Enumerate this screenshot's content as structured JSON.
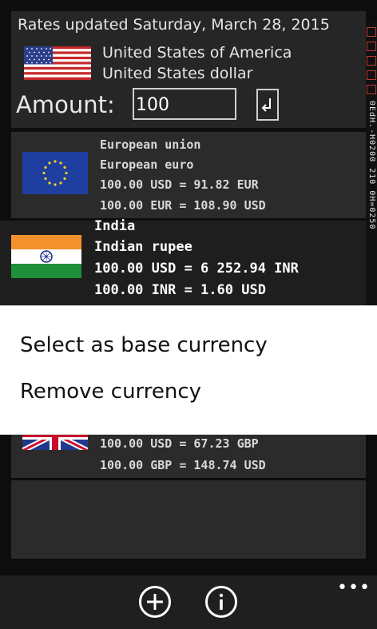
{
  "header": {
    "rates_updated": "Rates updated Saturday, March 28, 2015",
    "base_country": "United States of America",
    "base_currency": "United States dollar",
    "amount_label": "Amount:",
    "amount_value": "100"
  },
  "currencies": [
    {
      "country": "European union",
      "currency": "European euro",
      "rate_to": "100.00 USD = 91.82 EUR",
      "rate_from": "100.00 EUR = 108.90 USD"
    },
    {
      "country": "India",
      "currency": "Indian rupee",
      "rate_to": "100.00 USD = 6 252.94 INR",
      "rate_from": "100.00 INR = 1.60 USD"
    },
    {
      "country": "",
      "currency": "",
      "rate_to": "100.00 USD = 67.23 GBP",
      "rate_from": "100.00 GBP = 148.74 USD"
    }
  ],
  "context_menu": {
    "items": [
      "Select as base currency",
      "Remove currency"
    ]
  },
  "side_strip": {
    "text": "0EdH.-H0200 210 0H=0250"
  },
  "app_bar": {
    "add_icon": "add-icon",
    "info_icon": "info-icon",
    "more": "•••"
  },
  "colors": {
    "background": "#0d0d0d",
    "panel": "#2b2b2b",
    "menu_bg": "#ffffff",
    "accent_red": "#c0392b"
  }
}
